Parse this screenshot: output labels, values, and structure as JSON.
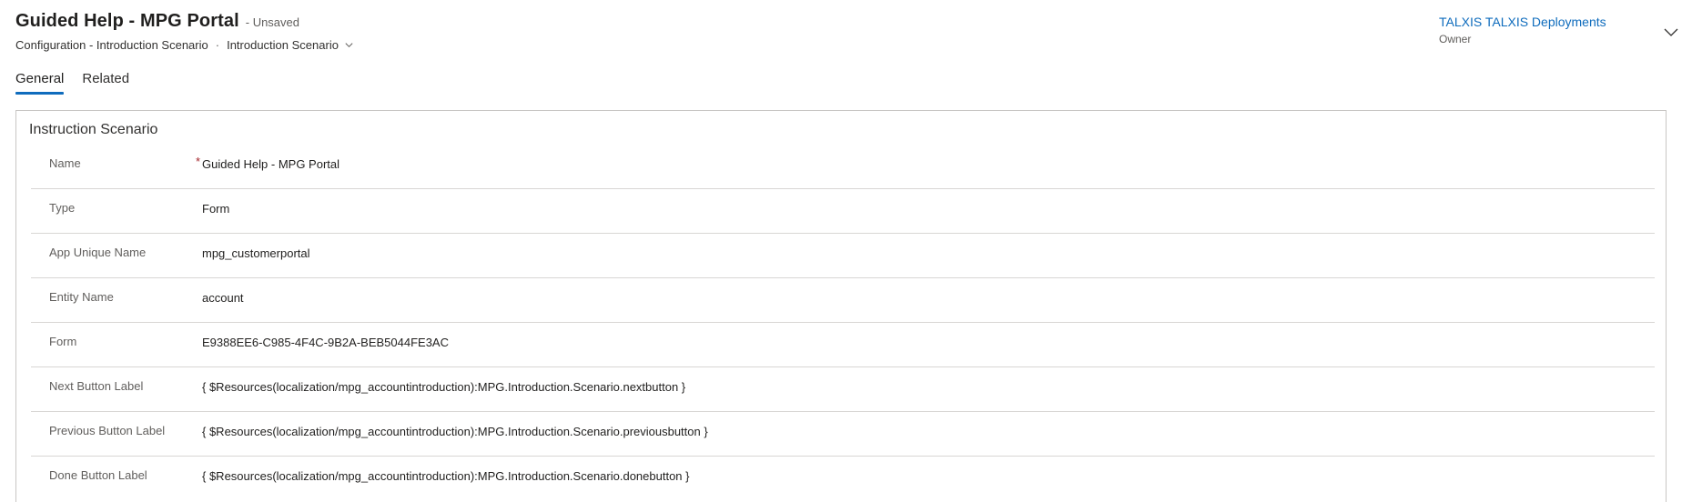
{
  "header": {
    "title": "Guided Help - MPG Portal",
    "save_status": "- Unsaved",
    "entity_label": "Configuration - Introduction Scenario",
    "separator": "·",
    "form_name": "Introduction Scenario",
    "owner": {
      "name": "TALXIS TALXIS Deployments",
      "label": "Owner"
    }
  },
  "tabs": [
    {
      "label": "General",
      "active": true
    },
    {
      "label": "Related",
      "active": false
    }
  ],
  "section": {
    "title": "Instruction Scenario",
    "fields": [
      {
        "label": "Name",
        "required_marker": "*",
        "value": "Guided Help - MPG Portal"
      },
      {
        "label": "Type",
        "value": "Form"
      },
      {
        "label": "App Unique Name",
        "value": "mpg_customerportal"
      },
      {
        "label": "Entity Name",
        "value": "account"
      },
      {
        "label": "Form",
        "value": "E9388EE6-C985-4F4C-9B2A-BEB5044FE3AC"
      },
      {
        "label": "Next Button Label",
        "value": "{ $Resources(localization/mpg_accountintroduction):MPG.Introduction.Scenario.nextbutton }"
      },
      {
        "label": "Previous Button Label",
        "value": "{ $Resources(localization/mpg_accountintroduction):MPG.Introduction.Scenario.previousbutton }"
      },
      {
        "label": "Done Button Label",
        "value": "{ $Resources(localization/mpg_accountintroduction):MPG.Introduction.Scenario.donebutton }"
      }
    ]
  },
  "icons": {
    "form_selector_chevron": "chevron-down-icon",
    "header_expand": "chevron-down-icon"
  },
  "colors": {
    "accent": "#0f6cbd",
    "required": "#a4262c",
    "border": "#c8c6c4"
  }
}
